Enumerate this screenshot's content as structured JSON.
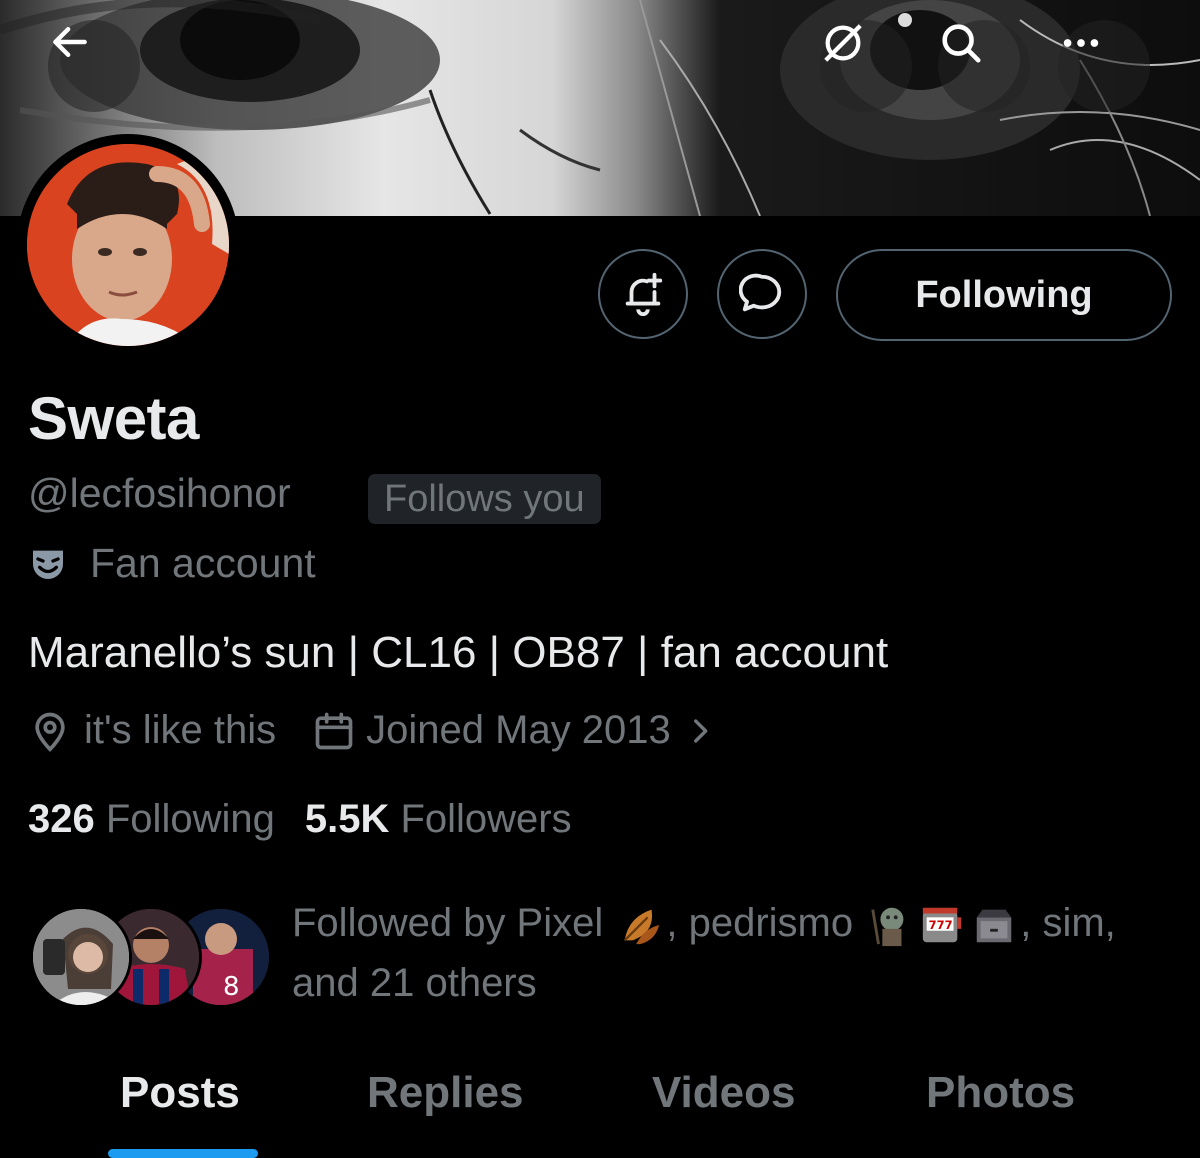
{
  "header": {
    "back_icon": "arrow-left-icon",
    "actions": [
      "grok-icon",
      "search-icon",
      "more-icon"
    ]
  },
  "profile": {
    "name": "Sweta",
    "handle": "@lecfosihonor",
    "follows_you": "Follows you",
    "category": "Fan account",
    "bio": "Maranello’s sun | CL16 | OB87 | fan account",
    "location": "it's like this",
    "joined": "Joined May 2013",
    "following_count": "326",
    "following_label": "Following",
    "followers_count": "5.5K",
    "followers_label": "Followers",
    "followed_by": {
      "prefix": "Followed by Pixel",
      "sep1": ", pedrismo",
      "sep2": ", sim,",
      "suffix": "and 21 others"
    }
  },
  "actions": {
    "notify_icon": "bell-plus-icon",
    "message_icon": "chat-bubble-icon",
    "following_button": "Following"
  },
  "tabs": [
    {
      "label": "Posts",
      "active": true
    },
    {
      "label": "Replies",
      "active": false
    },
    {
      "label": "Videos",
      "active": false
    },
    {
      "label": "Photos",
      "active": false
    }
  ],
  "colors": {
    "background": "#000000",
    "text_primary": "#e7e9ea",
    "text_secondary": "#71767b",
    "border": "#536471",
    "accent": "#1d9bf0"
  }
}
